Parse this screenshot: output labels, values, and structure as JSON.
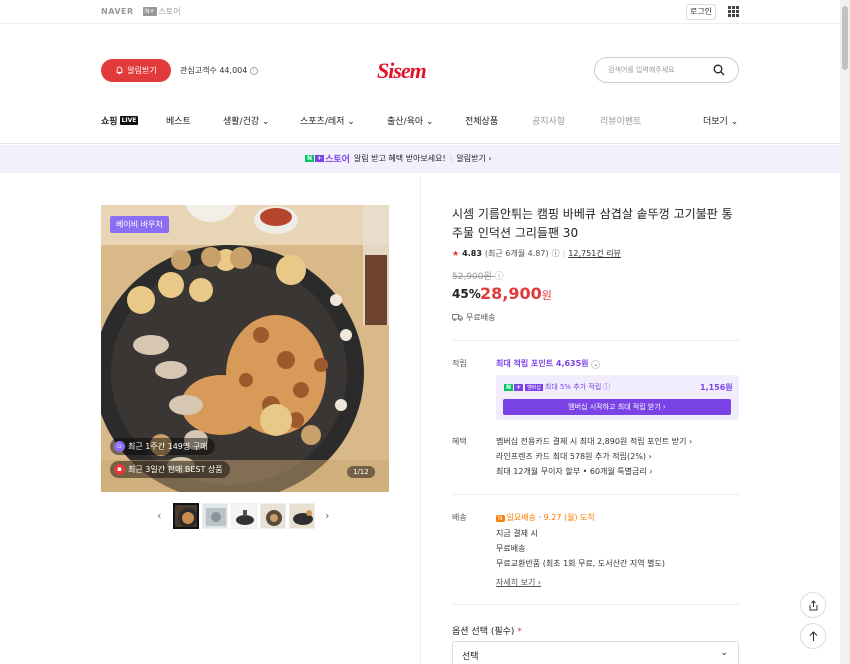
{
  "top": {
    "brand": "NAVER",
    "store": "스토어",
    "store_icon": "N+",
    "login": "로그인"
  },
  "header": {
    "alarm_label": "알림받기",
    "fav_label": "관심고객수 44,004",
    "logo": "Sisem",
    "search_placeholder": "검색어를 입력해주세요"
  },
  "nav": {
    "items": [
      "쇼핑",
      "베스트",
      "생활/건강",
      "스포츠/레저",
      "출산/육아",
      "전체상품",
      "공지사항",
      "리뷰이벤트",
      "더보기"
    ],
    "live_badge": "LIVE"
  },
  "banner": {
    "store_label": "스토어",
    "text": "알림 받고 혜택 받아보세요!",
    "action": "알림받기"
  },
  "gallery": {
    "badge": "베이비 바우처",
    "overlay1": "최근 1주간 149명 구매",
    "overlay2": "최근 3일간 판매 BEST 상품",
    "counter": "1/12",
    "thumb_count": 5
  },
  "product": {
    "title": "시셈 기름안튀는 캠핑 바베큐 삼겹살 솥뚜껑 고기불판 통주물 인덕션 그리들팬 30",
    "rating": "4.83",
    "rating_detail": "(최근 6개월 4.87)",
    "reviews": "12,751건 리뷰",
    "original_price": "52,900원",
    "discount": "45%",
    "price_num": "28,900",
    "price_unit": "원",
    "shipping_free": "무료배송"
  },
  "points": {
    "label": "적립",
    "max": "최대 적립 포인트 4,635원",
    "member_text": "최대 5% 추가 적립",
    "member_value": "1,156원",
    "member_btn": "멤버십 시작하고 최대 적립 받기"
  },
  "benefits": {
    "label": "혜택",
    "items": [
      "멤버십 전용카드 결제 시 최대 2,890원 적립 포인트 받기",
      "라인프렌즈 카드 최대 578원 추가 적립(2%)",
      "최대 12개월 무이자 할부 • 60개월 특별금리"
    ]
  },
  "delivery": {
    "label": "배송",
    "badge": "N",
    "arrive_label": "일요배송",
    "arrive_date": "9.27 (월) 도착",
    "line1": "지금 결제 시",
    "line2": "무료배송",
    "line3": "무료교환반품 (최초 1회 무료, 도서산간 지역 별도)",
    "more": "자세히 보기"
  },
  "option": {
    "label": "옵션 선택 (필수)",
    "required_mark": "*",
    "select": "선택"
  },
  "colors": {
    "accent": "#7a43e6",
    "price": "#e03a3a",
    "logo": "#e1132a"
  }
}
